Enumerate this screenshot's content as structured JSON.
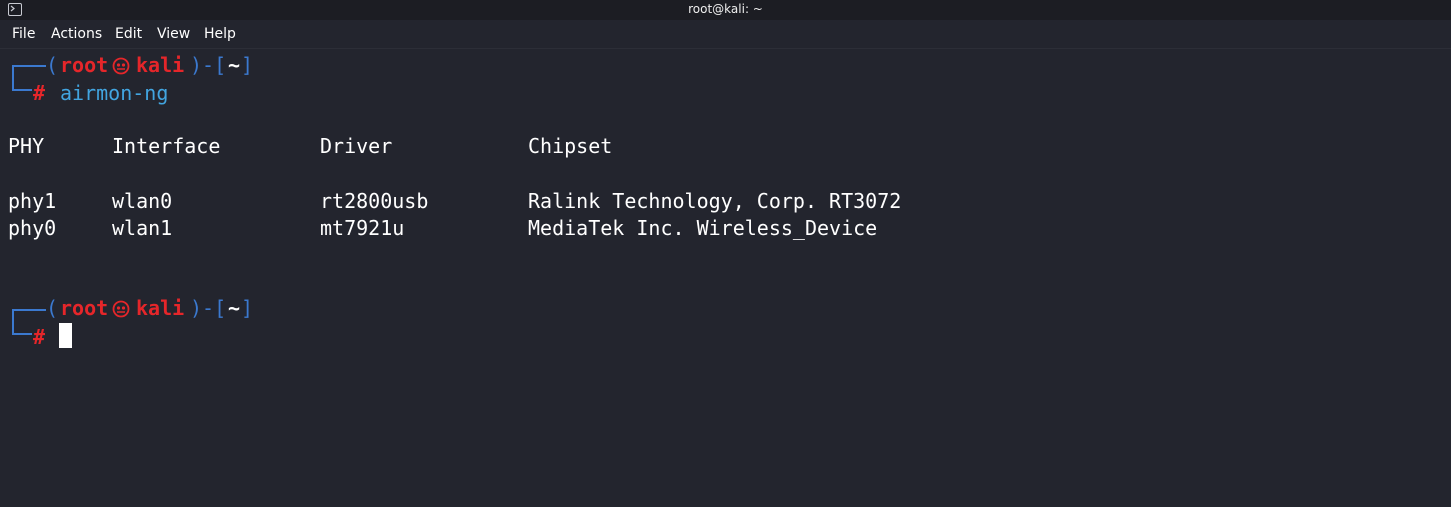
{
  "window": {
    "title": "root@kali: ~"
  },
  "menu": {
    "items": [
      "File",
      "Actions",
      "Edit",
      "View",
      "Help"
    ]
  },
  "prompt": {
    "open_paren": "(",
    "user": "root",
    "host": "kali",
    "close_dash": ")-[",
    "path": "~",
    "close_bracket": "]",
    "symbol": "#"
  },
  "command": "airmon-ng",
  "table": {
    "headers": [
      "PHY",
      "Interface",
      "Driver",
      "Chipset"
    ],
    "rows": [
      [
        "phy1",
        "wlan0",
        "rt2800usb",
        "Ralink Technology, Corp. RT3072"
      ],
      [
        "phy0",
        "wlan1",
        "mt7921u",
        "MediaTek Inc. Wireless_Device"
      ]
    ]
  },
  "colors": {
    "background": "#23252e",
    "frame_blue": "#3b79cf",
    "prompt_red": "#e5262a",
    "command_blue": "#42a5e0"
  },
  "icons": [
    "terminal-app-icon",
    "skull-icon",
    "block-cursor"
  ]
}
